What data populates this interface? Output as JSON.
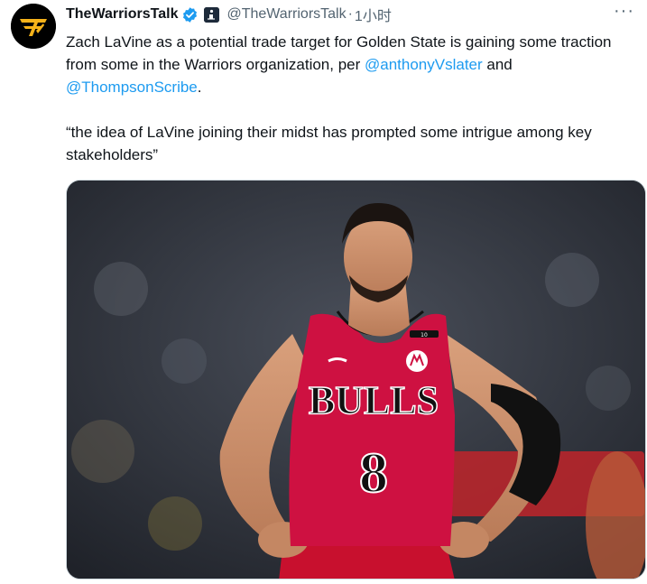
{
  "tweet": {
    "display_name": "TheWarriorsTalk",
    "handle": "@TheWarriorsTalk",
    "separator": "·",
    "timestamp": "1小时",
    "more_label": "···",
    "text_part1": "Zach LaVine as a potential trade target for Golden State is gaining some traction from some in the Warriors organization, per ",
    "mention1": "@anthonyVslater",
    "text_and": " and ",
    "mention2": "@ThompsonScribe",
    "text_period": ".",
    "quote": "“the idea of LaVine joining their midst has prompted some intrigue among key stakeholders”"
  },
  "media": {
    "jersey_text": "BULLS",
    "jersey_number": "8",
    "number_small": "10"
  },
  "colors": {
    "link": "#1d9bf0",
    "verified": "#1d9bf0",
    "jersey": "#ce1141"
  },
  "icons": [
    "warriors-logo-icon",
    "verified-badge-icon",
    "affiliate-badge-icon",
    "more-icon"
  ]
}
